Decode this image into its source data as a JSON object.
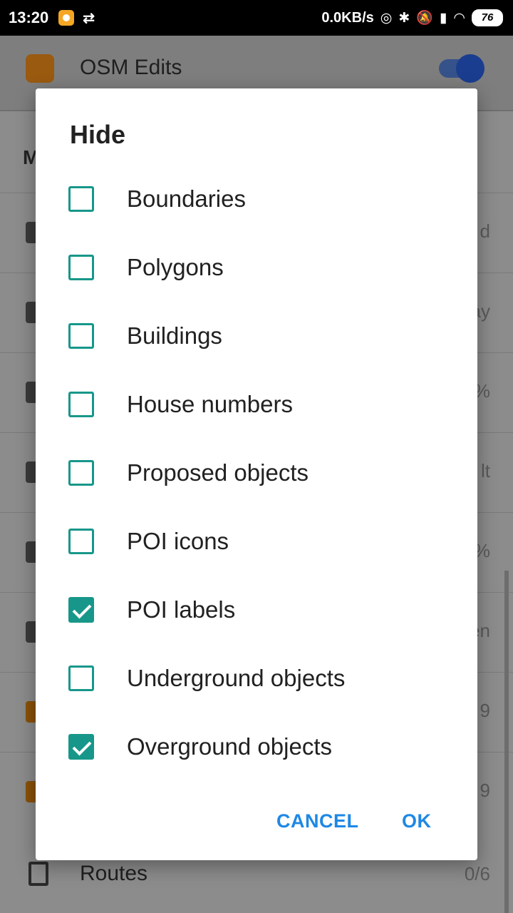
{
  "status_bar": {
    "time": "13:20",
    "net_speed": "0.0KB/s",
    "battery": "76"
  },
  "background": {
    "app_title": "OSM Edits",
    "section_initial": "M",
    "row_values": [
      "d",
      "ay",
      "%",
      "lt",
      "%",
      "en",
      "9",
      "9"
    ],
    "routes_label": "Routes",
    "routes_value": "0/6"
  },
  "dialog": {
    "title": "Hide",
    "options": [
      {
        "label": "Boundaries",
        "checked": false
      },
      {
        "label": "Polygons",
        "checked": false
      },
      {
        "label": "Buildings",
        "checked": false
      },
      {
        "label": "House numbers",
        "checked": false
      },
      {
        "label": "Proposed objects",
        "checked": false
      },
      {
        "label": "POI icons",
        "checked": false
      },
      {
        "label": "POI labels",
        "checked": true
      },
      {
        "label": "Underground objects",
        "checked": false
      },
      {
        "label": "Overground objects",
        "checked": true
      }
    ],
    "cancel_label": "CANCEL",
    "ok_label": "OK"
  },
  "colors": {
    "accent": "#17978a",
    "button": "#1e88e5"
  }
}
